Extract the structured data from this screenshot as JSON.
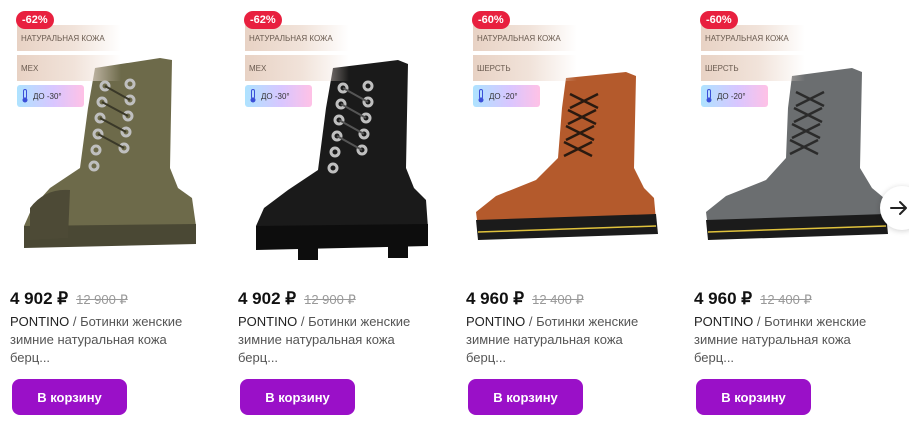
{
  "products": [
    {
      "discount": "-62%",
      "material": "НАТУРАЛЬНАЯ КОЖА",
      "lining": "МЕХ",
      "temperature": "ДО -30°",
      "price": "4 902 ₽",
      "old_price": "12 900 ₽",
      "brand": "PONTINO",
      "title": " / Ботинки женские зимние натуральная кожа берц...",
      "cart_label": "В корзину",
      "boot_color": "#6d6a4a",
      "boot_variant": "boot-olive"
    },
    {
      "discount": "-62%",
      "material": "НАТУРАЛЬНАЯ КОЖА",
      "lining": "МЕХ",
      "temperature": "ДО -30°",
      "price": "4 902 ₽",
      "old_price": "12 900 ₽",
      "brand": "PONTINO",
      "title": " / Ботинки женские зимние натуральная кожа берц...",
      "cart_label": "В корзину",
      "boot_color": "#1a1a1a",
      "boot_variant": "boot-black"
    },
    {
      "discount": "-60%",
      "material": "НАТУРАЛЬНАЯ КОЖА",
      "lining": "ШЕРСТЬ",
      "temperature": "ДО -20°",
      "price": "4 960 ₽",
      "old_price": "12 400 ₽",
      "brand": "PONTINO",
      "title": " / Ботинки женские зимние натуральная кожа берц...",
      "cart_label": "В корзину",
      "boot_color": "#b45a2c",
      "boot_variant": "boot-rust"
    },
    {
      "discount": "-60%",
      "material": "НАТУРАЛЬНАЯ КОЖА",
      "lining": "ШЕРСТЬ",
      "temperature": "ДО -20°",
      "price": "4 960 ₽",
      "old_price": "12 400 ₽",
      "brand": "PONTINO",
      "title": " / Ботинки женские зимние натуральная кожа берц...",
      "cart_label": "В корзину",
      "boot_color": "#6b6e70",
      "boot_variant": "boot-grey"
    }
  ],
  "carousel": {
    "next_icon": "arrow-right-icon"
  },
  "colors": {
    "accent": "#9a10c8",
    "discount": "#e8203f"
  }
}
